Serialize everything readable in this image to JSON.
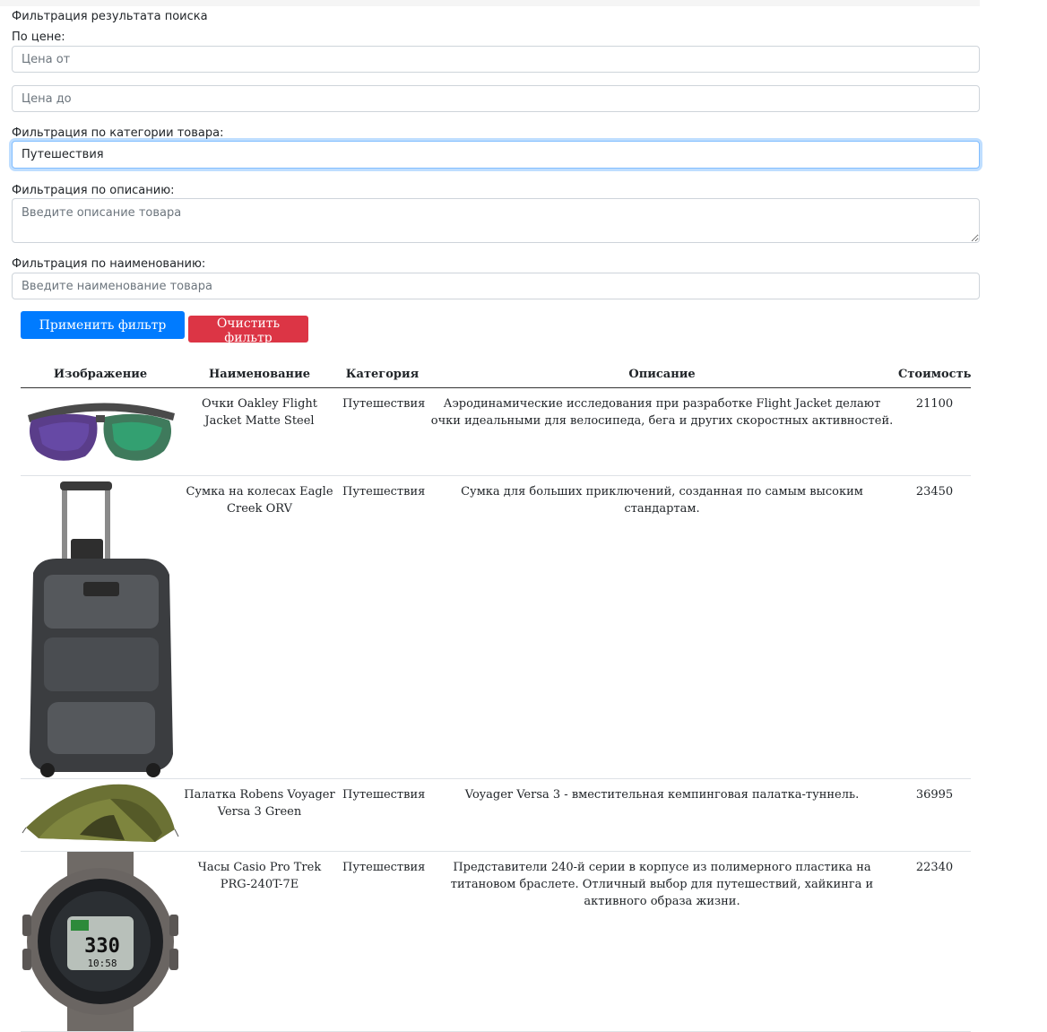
{
  "filter": {
    "title": "Фильтрация результата поиска",
    "price_label": "По цене:",
    "price_from_placeholder": "Цена от",
    "price_to_placeholder": "Цена до",
    "category_label": "Фильтрация по категории товара:",
    "category_value": "Путешествия",
    "description_label": "Фильтрация по описанию:",
    "description_placeholder": "Введите описание товара",
    "name_label": "Фильтрация по наименованию:",
    "name_placeholder": "Введите наименование товара",
    "apply_label": "Применить фильтр",
    "clear_label": "Очистить фильтр"
  },
  "colors": {
    "apply": "#007bff",
    "clear": "#dc3545",
    "focus": "#80bdff"
  },
  "table": {
    "headers": {
      "image": "Изображение",
      "name": "Наименование",
      "category": "Категория",
      "description": "Описание",
      "price": "Стоимость"
    },
    "rows": [
      {
        "image_icon": "sunglasses-image",
        "name": "Очки Oakley Flight Jacket Matte Steel",
        "category": "Путешествия",
        "description": "Аэродинамические исследования при разработке Flight Jacket делают очки идеальными для велосипеда, бега и других скоростных активностей.",
        "price": "21100"
      },
      {
        "image_icon": "luggage-image",
        "name": "Сумка на колесах Eagle Creek ORV",
        "category": "Путешествия",
        "description": "Сумка для больших приключений, созданная по самым высоким стандартам.",
        "price": "23450"
      },
      {
        "image_icon": "tent-image",
        "name": "Палатка Robens Voyager Versa 3 Green",
        "category": "Путешествия",
        "description": "Voyager Versa 3 - вместительная кемпинговая палатка-туннель.",
        "price": "36995"
      },
      {
        "image_icon": "watch-image",
        "name": "Часы Casio Pro Trek PRG-240T-7E",
        "category": "Путешествия",
        "description": "Представители 240-й серии в корпусе из полимерного пластика на титановом браслете. Отличный выбор для путешествий, хайкинга и активного образа жизни.",
        "price": "22340"
      }
    ]
  }
}
